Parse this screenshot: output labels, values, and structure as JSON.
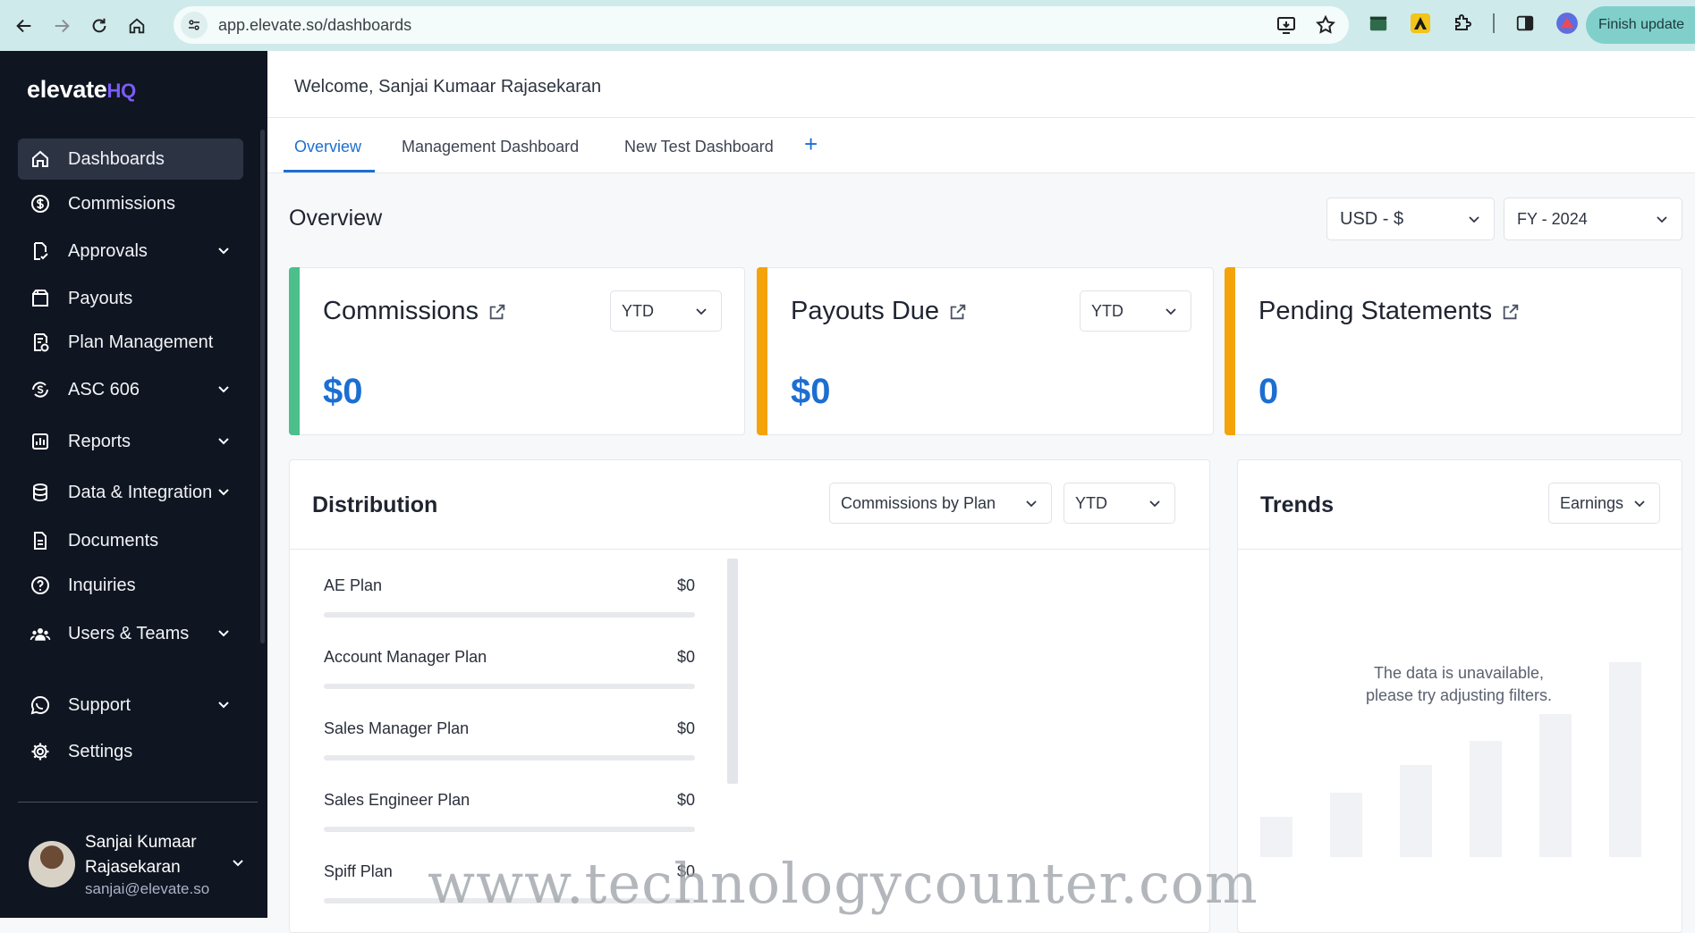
{
  "browser": {
    "url": "app.elevate.so/dashboards",
    "finish_update": "Finish update"
  },
  "sidebar": {
    "logo_main": "elevate",
    "logo_suffix": "HQ",
    "items": [
      {
        "label": "Dashboards",
        "icon": "home-icon"
      },
      {
        "label": "Commissions",
        "icon": "dollar-circle-icon"
      },
      {
        "label": "Approvals",
        "icon": "approval-doc-icon"
      },
      {
        "label": "Payouts",
        "icon": "payout-icon"
      },
      {
        "label": "Plan Management",
        "icon": "plan-icon"
      },
      {
        "label": "ASC 606",
        "icon": "cycle-dollar-icon"
      },
      {
        "label": "Reports",
        "icon": "reports-icon"
      },
      {
        "label": "Data & Integration",
        "icon": "database-icon"
      },
      {
        "label": "Documents",
        "icon": "document-icon"
      },
      {
        "label": "Inquiries",
        "icon": "question-circle-icon"
      },
      {
        "label": "Users & Teams",
        "icon": "users-icon"
      },
      {
        "label": "Support",
        "icon": "chat-icon"
      },
      {
        "label": "Settings",
        "icon": "gear-icon"
      }
    ],
    "user": {
      "name": "Sanjai Kumaar Rajasekaran",
      "email": "sanjai@elevate.so"
    }
  },
  "header": {
    "welcome": "Welcome, Sanjai Kumaar Rajasekaran"
  },
  "tabs": [
    {
      "label": "Overview",
      "active": true
    },
    {
      "label": "Management Dashboard"
    },
    {
      "label": "New Test Dashboard"
    }
  ],
  "overview": {
    "title": "Overview",
    "currency": "USD - $",
    "fiscal_year": "FY - 2024"
  },
  "cards": [
    {
      "title": "Commissions",
      "value": "$0",
      "period": "YTD",
      "accent": "#4cbf8a"
    },
    {
      "title": "Payouts Due",
      "value": "$0",
      "period": "YTD",
      "accent": "#f5a30a"
    },
    {
      "title": "Pending Statements",
      "value": "0",
      "accent": "#f5a30a"
    }
  ],
  "distribution": {
    "title": "Distribution",
    "group_by": "Commissions by Plan",
    "period": "YTD",
    "rows": [
      {
        "label": "AE Plan",
        "value": "$0"
      },
      {
        "label": "Account Manager Plan",
        "value": "$0"
      },
      {
        "label": "Sales Manager Plan",
        "value": "$0"
      },
      {
        "label": "Sales Engineer Plan",
        "value": "$0"
      },
      {
        "label": "Spiff Plan",
        "value": "$0"
      }
    ]
  },
  "trends": {
    "title": "Trends",
    "metric": "Earnings",
    "empty_line1": "The data is unavailable,",
    "empty_line2": "please try adjusting filters."
  },
  "watermark": "www.technologycounter.com"
}
